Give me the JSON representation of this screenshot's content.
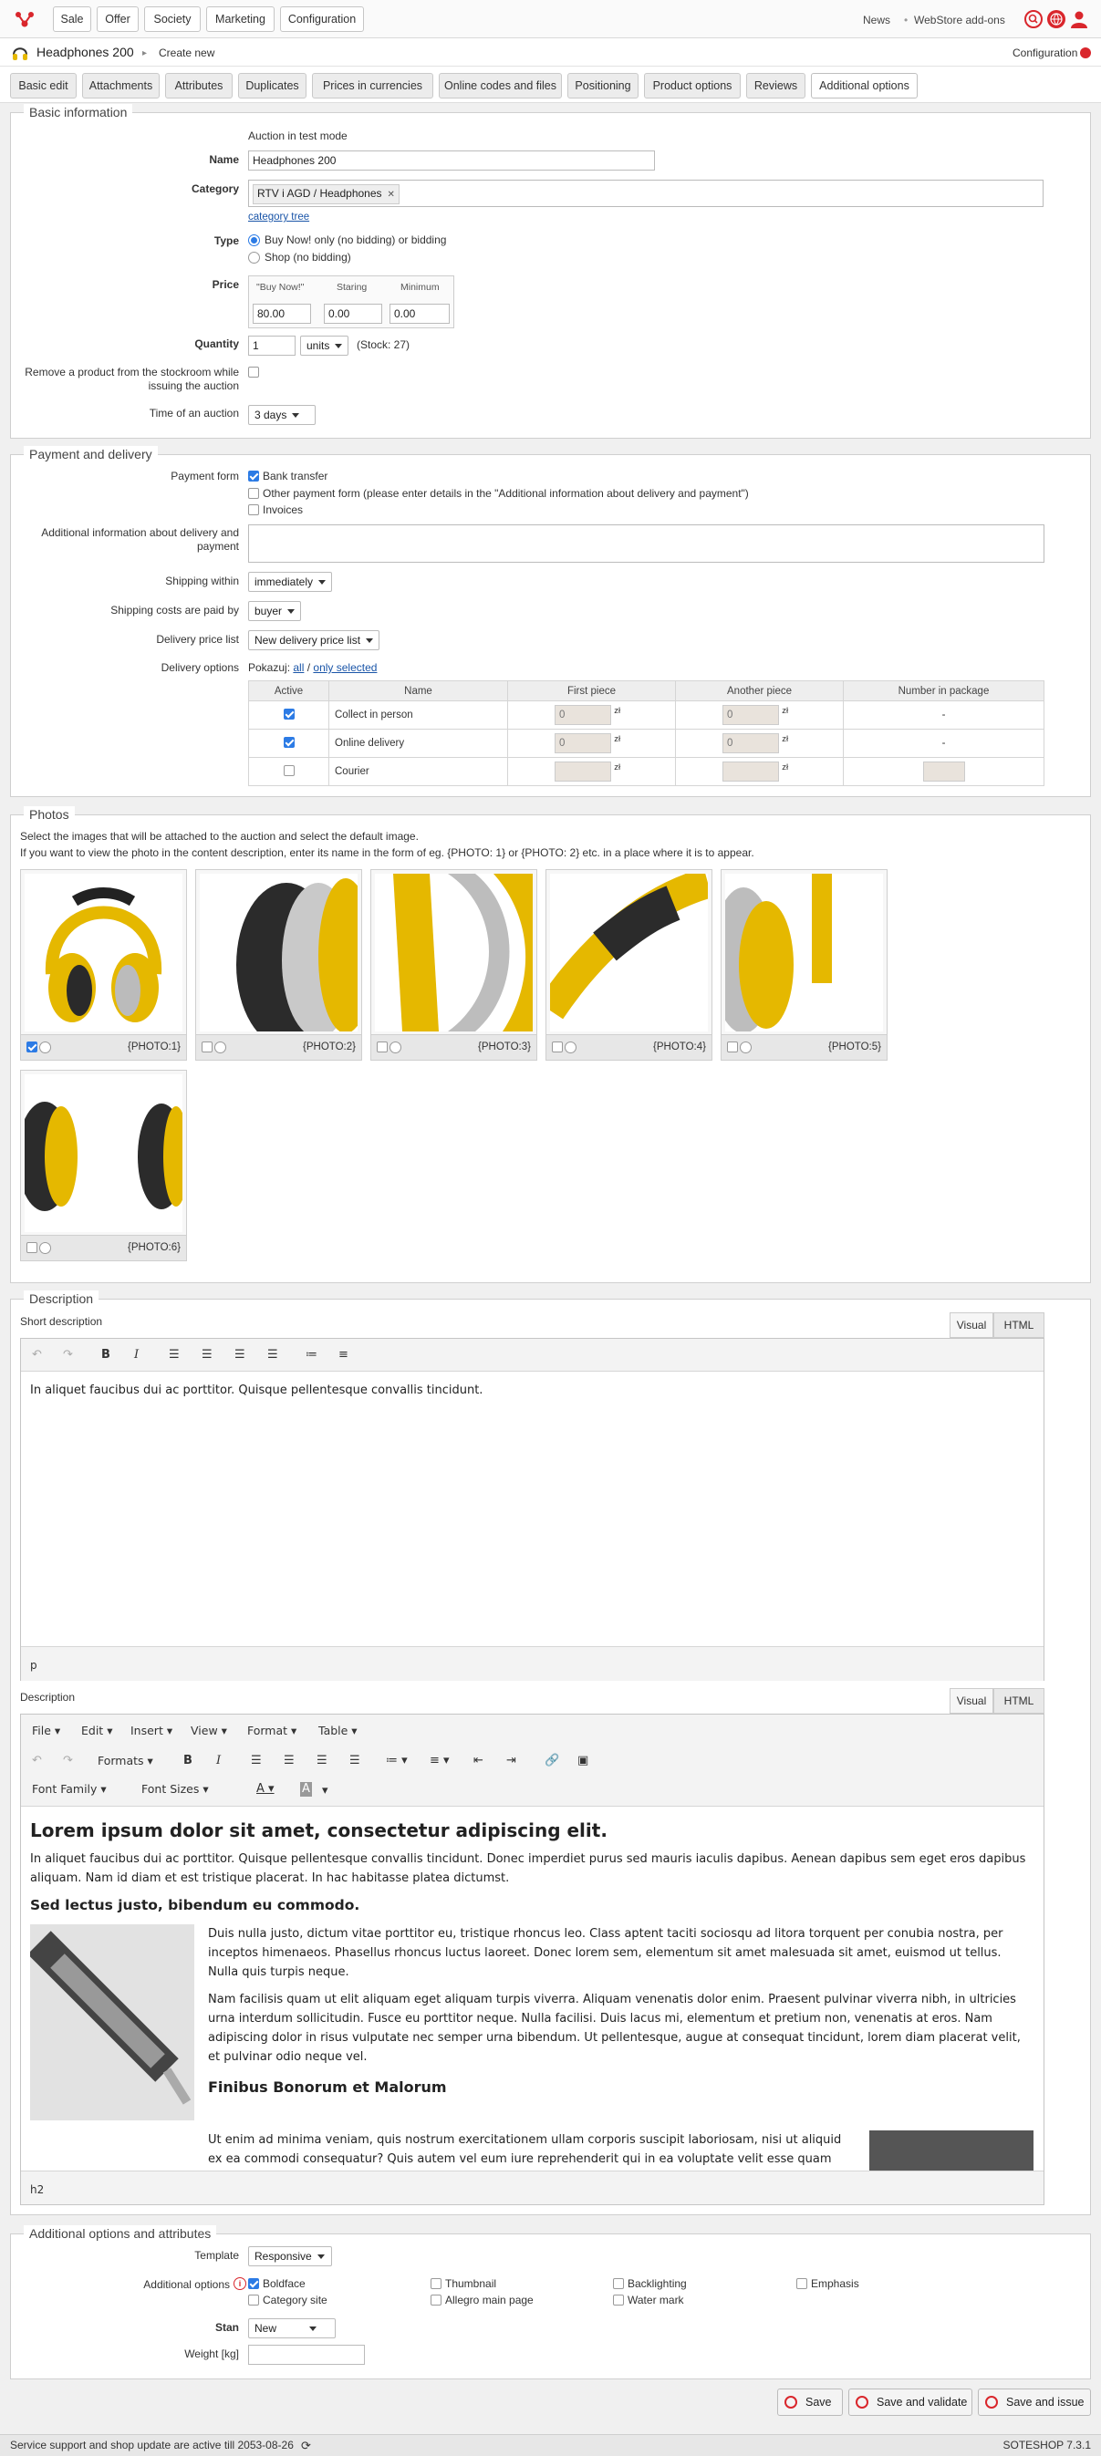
{
  "nav": {
    "items": [
      "Sale",
      "Offer",
      "Society",
      "Marketing",
      "Configuration"
    ],
    "news": "News",
    "addons": "WebStore add-ons"
  },
  "header": {
    "product_title": "Headphones 200",
    "breadcrumb_action": "Create new",
    "config_link": "Configuration"
  },
  "tabs": [
    "Basic edit",
    "Attachments",
    "Attributes",
    "Duplicates",
    "Prices in currencies",
    "Online codes and files",
    "Positioning",
    "Product options",
    "Reviews",
    "Additional options"
  ],
  "basic": {
    "legend": "Basic information",
    "test_mode": "Auction in test mode",
    "name_label": "Name",
    "name_value": "Headphones 200",
    "category_label": "Category",
    "category_tag": "RTV i AGD / Headphones",
    "category_tree_link": "category tree",
    "type_label": "Type",
    "type_option1": "Buy Now! only (no bidding) or bidding",
    "type_option2": "Shop (no bidding)",
    "price_label": "Price",
    "price_headers": [
      "\"Buy Now!\"",
      "Staring",
      "Minimum"
    ],
    "price_values": [
      "80.00",
      "0.00",
      "0.00"
    ],
    "quantity_label": "Quantity",
    "quantity_value": "1",
    "units": "units",
    "stock": "(Stock: 27)",
    "remove_label": "Remove a product from the stockroom while issuing the auction",
    "time_label": "Time of an auction",
    "time_value": "3 days"
  },
  "payment": {
    "legend": "Payment and delivery",
    "form_label": "Payment form",
    "form_options": [
      "Bank transfer",
      "Other payment form (please enter details in the \"Additional information about delivery and payment\")",
      "Invoices"
    ],
    "additional_label": "Additional information about delivery and payment",
    "shipping_within_label": "Shipping within",
    "shipping_within_value": "immediately",
    "paid_by_label": "Shipping costs are paid by",
    "paid_by_value": "buyer",
    "price_list_label": "Delivery price list",
    "price_list_value": "New delivery price list",
    "delivery_options_label": "Delivery options",
    "show_prefix": "Pokazuj:",
    "show_all": "all",
    "show_selected": "only selected",
    "table_headers": [
      "Active",
      "Name",
      "First piece",
      "Another piece",
      "Number in package"
    ],
    "rows": [
      {
        "name": "Collect in person",
        "first": "0",
        "another": "0",
        "number": "-",
        "currency": "zł"
      },
      {
        "name": "Online delivery",
        "first": "0",
        "another": "0",
        "number": "-",
        "currency": "zł"
      },
      {
        "name": "Courier",
        "first": "",
        "another": "",
        "number": "",
        "currency": "zł"
      }
    ]
  },
  "photos": {
    "legend": "Photos",
    "hint1": "Select the images that will be attached to the auction and select the default image.",
    "hint2": "If you want to view the photo in the content description, enter its name in the form of eg. {PHOTO: 1} or {PHOTO: 2} etc. in a place where it is to appear.",
    "items": [
      "{PHOTO:1}",
      "{PHOTO:2}",
      "{PHOTO:3}",
      "{PHOTO:4}",
      "{PHOTO:5}",
      "{PHOTO:6}"
    ]
  },
  "description": {
    "legend": "Description",
    "short_label": "Short description",
    "visual": "Visual",
    "html": "HTML",
    "short_text": "In aliquet faucibus dui ac porttitor. Quisque pellentesque convallis tincidunt.",
    "short_status": "p",
    "desc_label": "Description",
    "menus": [
      "File",
      "Edit",
      "Insert",
      "View",
      "Format",
      "Table"
    ],
    "formats": "Formats",
    "font_family": "Font Family",
    "font_sizes": "Font Sizes",
    "h1": "Lorem ipsum dolor sit amet, consectetur adipiscing elit.",
    "p1": "In aliquet faucibus dui ac porttitor. Quisque pellentesque convallis tincidunt. Donec imperdiet purus sed mauris iaculis dapibus. Aenean dapibus sem eget eros dapibus aliquam. Nam id diam et est tristique placerat. In hac habitasse platea dictumst.",
    "h2": "Sed lectus justo, bibendum eu commodo.",
    "p2": "Duis nulla justo, dictum vitae porttitor eu, tristique rhoncus leo. Class aptent taciti sociosqu ad litora torquent per conubia nostra, per inceptos himenaeos. Phasellus rhoncus luctus laoreet. Donec lorem sem, elementum sit amet malesuada sit amet, euismod ut tellus. Nulla quis turpis neque.",
    "p3": "Nam facilisis quam ut elit aliquam eget aliquam turpis viverra. Aliquam venenatis dolor enim. Praesent pulvinar viverra nibh, in ultricies urna interdum sollicitudin. Fusce eu porttitor neque. Nulla facilisi. Duis lacus mi, elementum et pretium non, venenatis at eros. Nam adipiscing dolor in risus vulputate nec semper urna bibendum. Ut pellentesque, augue at consequat tincidunt, lorem diam placerat velit, et pulvinar odio neque vel.",
    "h3": "Finibus Bonorum et Malorum",
    "p4": "Ut enim ad minima veniam, quis nostrum exercitationem ullam corporis suscipit laboriosam, nisi ut aliquid ex ea commodi consequatur? Quis autem vel eum iure reprehenderit qui in ea voluptate velit esse quam nihil molestiae consequatur, vel illum qui dolorem eum fugiat quo voluptas nulla pariatur? At vero eos et accusamus et iusto odio dignissimos",
    "status": "h2"
  },
  "additional": {
    "legend": "Additional options and attributes",
    "template_label": "Template",
    "template_value": "Responsive",
    "options_label": "Additional options",
    "options": [
      {
        "label": "Boldface",
        "checked": true
      },
      {
        "label": "Thumbnail",
        "checked": false
      },
      {
        "label": "Backlighting",
        "checked": false
      },
      {
        "label": "Emphasis",
        "checked": false
      },
      {
        "label": "Category site",
        "checked": false
      },
      {
        "label": "Allegro main page",
        "checked": false
      },
      {
        "label": "Water mark",
        "checked": false
      }
    ],
    "stan_label": "Stan",
    "stan_value": "New",
    "weight_label": "Weight [kg]",
    "weight_value": ""
  },
  "actions": {
    "save": "Save",
    "save_validate": "Save and validate",
    "save_issue": "Save and issue"
  },
  "footer": {
    "support": "Service support and shop update are active till 2053-08-26",
    "version": "SOTESHOP 7.3.1"
  },
  "colors": {
    "accent": "#d9262c",
    "link": "#1a55a8",
    "check": "#2c7be5"
  }
}
